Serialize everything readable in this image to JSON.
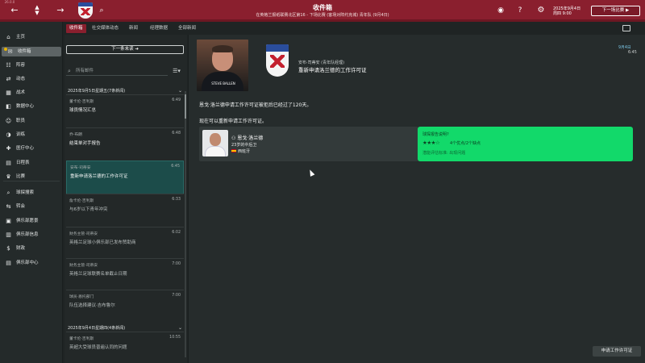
{
  "topbar": {
    "title": "收件箱",
    "subtitle": "在英格兰报纸联赛北区第16 - 下场比赛 (客场对阵约克城) 青年队 (9月4日)",
    "date_line1": "2025年9月4日",
    "date_line2": "周四 9:00",
    "continue_label": "下一场比赛",
    "version": "26.0.0"
  },
  "sidebar": {
    "items": [
      {
        "label": "主页",
        "icon": "home-icon"
      },
      {
        "label": "收件箱",
        "icon": "inbox-icon",
        "active": true
      },
      {
        "label": "阵容",
        "icon": "squad-icon"
      },
      {
        "label": "动态",
        "icon": "dynamics-icon"
      },
      {
        "label": "战术",
        "icon": "tactics-icon"
      },
      {
        "label": "数据中心",
        "icon": "data-hub-icon"
      },
      {
        "label": "职员",
        "icon": "staff-icon"
      },
      {
        "label": "训练",
        "icon": "training-icon"
      },
      {
        "label": "医疗中心",
        "icon": "medical-icon"
      },
      {
        "label": "日程表",
        "icon": "schedule-icon"
      },
      {
        "label": "比赛",
        "icon": "competitions-icon"
      },
      {
        "label": "球探搜索",
        "icon": "scouting-icon"
      },
      {
        "label": "转会",
        "icon": "transfers-icon"
      },
      {
        "label": "俱乐部愿景",
        "icon": "club-vision-icon"
      },
      {
        "label": "俱乐部信息",
        "icon": "club-info-icon"
      },
      {
        "label": "财政",
        "icon": "finances-icon"
      },
      {
        "label": "俱乐部中心",
        "icon": "club-centre-icon"
      }
    ]
  },
  "tabs": [
    "收件箱",
    "社交媒体动态",
    "新闻",
    "经理数据",
    "全部新闻"
  ],
  "inbox": {
    "next_unread_label": "下一条未读",
    "search_placeholder": "所有邮件",
    "groups": [
      {
        "label": "2025年9月5日星期五(7条新闻)"
      },
      {
        "label": "2025年9月4日星期四(4条新闻)"
      }
    ],
    "messages": [
      {
        "sender": "董卡伦·吉利斯",
        "time": "6:49",
        "subject": "球员情况汇总"
      },
      {
        "sender": "乔·布朗",
        "time": "6:48",
        "subject": "结束单对手报告"
      },
      {
        "sender": "安布·司蒂安",
        "time": "6:45",
        "subject": "重新申请洛兰德的工作许可证"
      },
      {
        "sender": "詹卡伦·吉利斯",
        "time": "6:33",
        "subject": "与6岁以下青年冲突"
      },
      {
        "sender": "财务主管·司蒂安",
        "time": "6:02",
        "subject": "英格兰足球小俱乐部已发布赞助商"
      },
      {
        "sender": "财务主管·司蒂安",
        "time": "7:00",
        "subject": "英格兰足球联赛名单截止日期"
      },
      {
        "sender": "球员·恩托部门",
        "time": "7:00",
        "subject": "队伍选择建议·吉布鲁尔"
      },
      {
        "sender": "董卡伦·吉利斯",
        "time": "10:55",
        "subject": "英超大受球员普遍认同的问题"
      }
    ]
  },
  "message": {
    "from": "安布·司蒂安 (青年队经理)",
    "title": "重新申请洛兰德的工作许可证",
    "date": "9月4日",
    "time": "6:45",
    "body1": "恩戈·洛兰德申请工作许可证被拒后已经过了120天。",
    "body2": "现在可以重新申请工作许可证。",
    "player": {
      "name": "恩戈·洛兰德",
      "age": "23岁的中后卫",
      "nationality": "西班牙"
    },
    "scout": {
      "header": "球探报告说明?",
      "stars": "★★★☆",
      "text": "4个优点/2个缺点",
      "sub": "潜能评估标准: 出现问题"
    },
    "action_label": "申请工作许可证"
  },
  "colors": {
    "brand": "#8a1f2e",
    "accent_green": "#12d96a",
    "selected_row": "#1c4c4a"
  }
}
